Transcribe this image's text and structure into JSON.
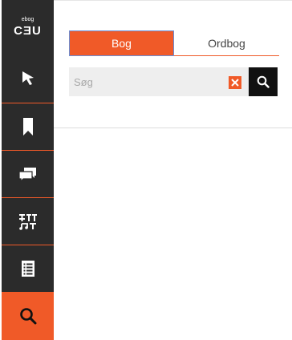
{
  "sidebar": {
    "logo_small": "ebog",
    "logo_big": "CƎU",
    "items": [
      {
        "icon": "pointer-icon"
      },
      {
        "icon": "bookmark-icon"
      },
      {
        "icon": "comments-icon"
      },
      {
        "icon": "glossary-icon"
      },
      {
        "icon": "toc-icon"
      },
      {
        "icon": "search-icon",
        "active": true
      }
    ]
  },
  "tabs": [
    {
      "label": "Bog",
      "active": true
    },
    {
      "label": "Ordbog",
      "active": false
    }
  ],
  "search": {
    "placeholder": "Søg",
    "value": ""
  },
  "colors": {
    "accent": "#f05a28",
    "sidebar_bg": "#2b2b2b",
    "search_bg": "#eeeeee",
    "search_button": "#111111"
  }
}
